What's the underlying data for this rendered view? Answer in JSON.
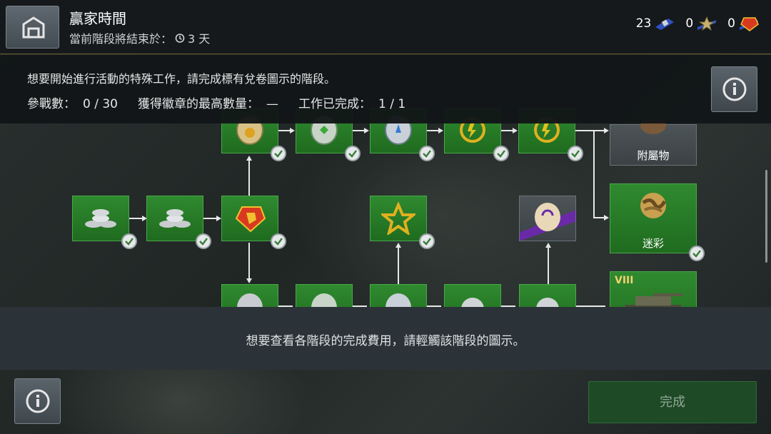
{
  "header": {
    "title": "贏家時間",
    "subtitle_label": "當前階段將結束於：",
    "subtitle_value": "3 天",
    "currencies": [
      {
        "value": "23",
        "icon": "blue-tag-icon"
      },
      {
        "value": "0",
        "icon": "star-medal-icon"
      },
      {
        "value": "0",
        "icon": "red-bond-icon"
      }
    ]
  },
  "info": {
    "line1": "想要開始進行活動的特殊工作，請完成標有兌卷圖示的階段。",
    "battles_label": "參戰數：",
    "battles_value": "0 / 30",
    "medals_label": "獲得徽章的最高數量：",
    "medals_value": "—",
    "tasks_label": "工作已完成：",
    "tasks_value": "1 / 1"
  },
  "tree": {
    "attachments_label": "附屬物",
    "camo_label": "迷彩",
    "tier_label": "VIII"
  },
  "hint": {
    "text": "想要查看各階段的完成費用，請輕觸該階段的圖示。"
  },
  "footer": {
    "done_label": "完成"
  },
  "colors": {
    "node_green": "#2f8a2f",
    "node_grey": "#4d5458",
    "header_bg": "#15191c",
    "accent_gold": "#6b5a2e",
    "done_button": "#1e4a25"
  }
}
